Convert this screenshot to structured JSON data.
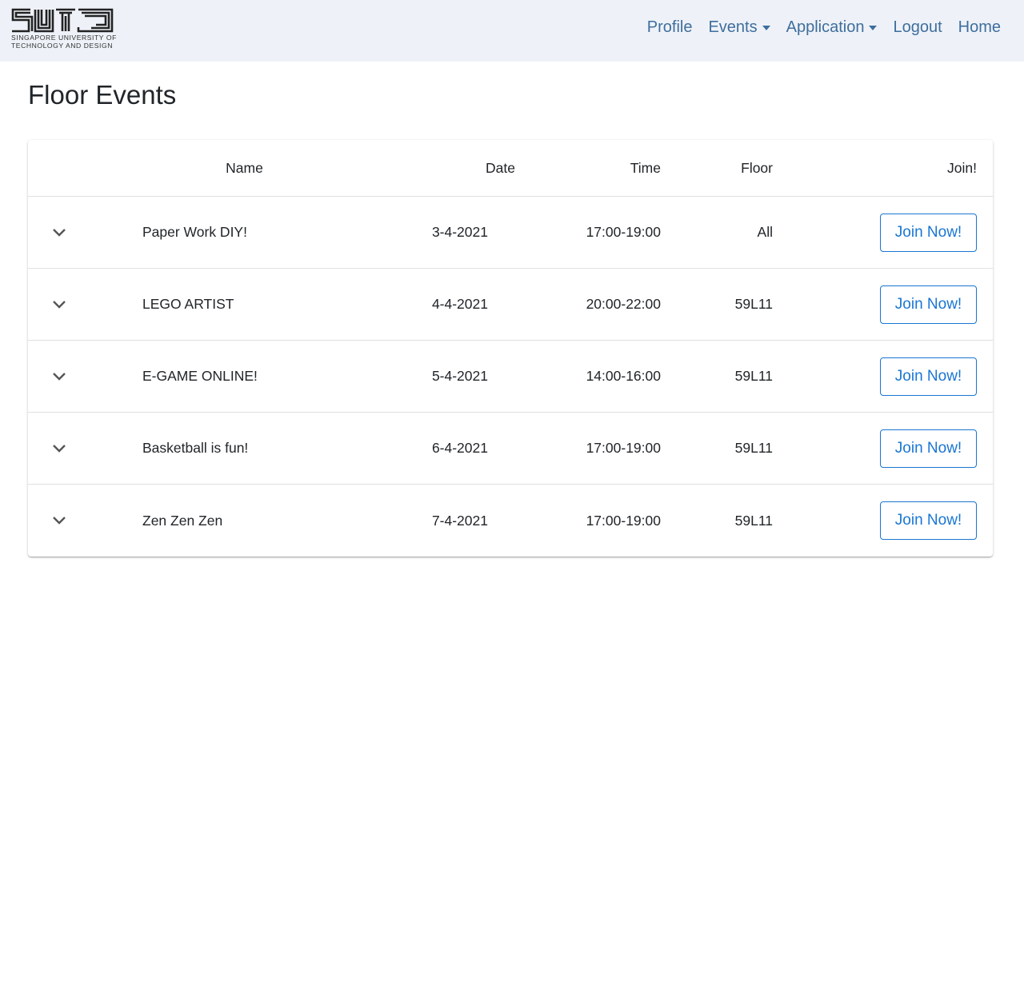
{
  "logo": {
    "line1": "SINGAPORE UNIVERSITY OF",
    "line2": "TECHNOLOGY AND DESIGN"
  },
  "nav": {
    "profile": "Profile",
    "events": "Events",
    "application": "Application",
    "logout": "Logout",
    "home": "Home"
  },
  "page": {
    "title": "Floor Events"
  },
  "table": {
    "headers": {
      "name": "Name",
      "date": "Date",
      "time": "Time",
      "floor": "Floor",
      "join": "Join!"
    },
    "rows": [
      {
        "name": "Paper Work DIY!",
        "date": "3-4-2021",
        "time": "17:00-19:00",
        "floor": "All",
        "button": "Join Now!"
      },
      {
        "name": "LEGO ARTIST",
        "date": "4-4-2021",
        "time": "20:00-22:00",
        "floor": "59L11",
        "button": "Join Now!"
      },
      {
        "name": "E-GAME ONLINE!",
        "date": "5-4-2021",
        "time": "14:00-16:00",
        "floor": "59L11",
        "button": "Join Now!"
      },
      {
        "name": "Basketball is fun!",
        "date": "6-4-2021",
        "time": "17:00-19:00",
        "floor": "59L11",
        "button": "Join Now!"
      },
      {
        "name": "Zen Zen Zen",
        "date": "7-4-2021",
        "time": "17:00-19:00",
        "floor": "59L11",
        "button": "Join Now!"
      }
    ]
  },
  "colors": {
    "navbar_bg": "#eef2f8",
    "nav_link": "#3f6e9d",
    "button_accent": "#1976d2"
  }
}
